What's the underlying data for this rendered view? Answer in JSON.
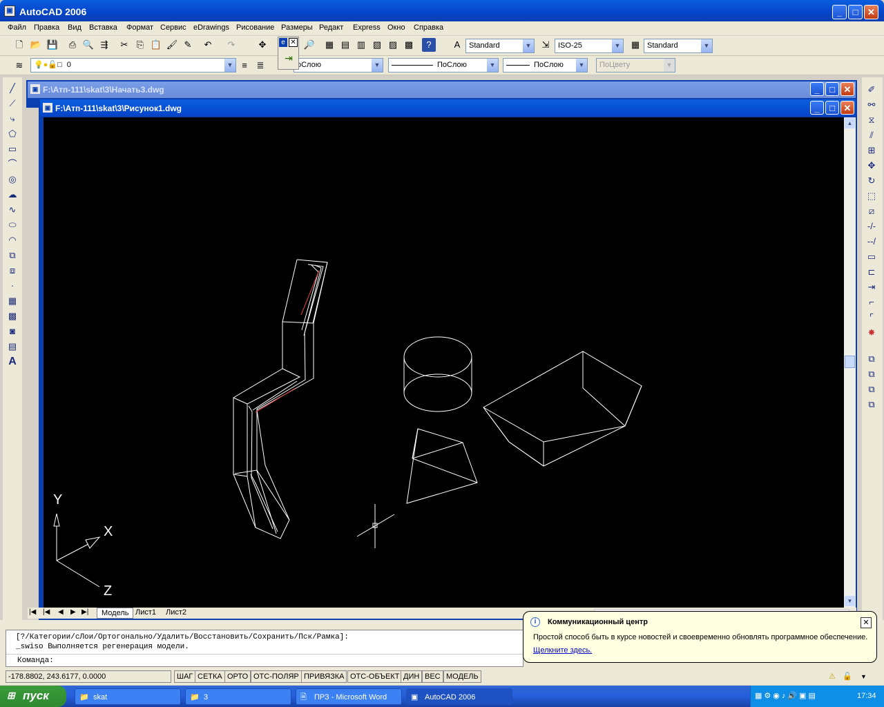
{
  "app": {
    "title": "AutoCAD 2006"
  },
  "menu": [
    "Файл",
    "Правка",
    "Вид",
    "Вставка",
    "Формат",
    "Сервис",
    "eDrawings",
    "Рисование",
    "Размеры",
    "Редакт",
    "Express",
    "Окно",
    "Справка"
  ],
  "styles": {
    "text_style": "Standard",
    "dim_style": "ISO-25",
    "table_style": "Standard"
  },
  "layers": {
    "current_layer": "0",
    "color": "оСлою",
    "linetype": "ПоСлою",
    "lineweight": "ПоСлою",
    "plotstyle": "ПоЦвету"
  },
  "popup_toolbar": {
    "label": "e"
  },
  "documents": [
    {
      "title": "F:\\Атп-111\\skat\\3\\Начать3.dwg"
    },
    {
      "title": "F:\\Атп-111\\skat\\3\\Рисунок1.dwg"
    }
  ],
  "ucs": {
    "y": "Y",
    "x": "X",
    "z": "Z"
  },
  "layout_tabs": [
    "Модель",
    "Лист1",
    "Лист2"
  ],
  "command": {
    "line1": "[?/Категории/сЛои/Ортогонально/Удалить/Восстановить/Сохранить/Пск/Рамка]:",
    "line2": "_swiso Выполняется регенерация модели.",
    "prompt": "Команда:"
  },
  "status": {
    "coords": "-178.8802, 243.6177, 0.0000",
    "buttons": [
      "ШАГ",
      "СЕТКА",
      "ОРТО",
      "ОТС-ПОЛЯР",
      "ПРИВЯЗКА",
      "ОТС-ОБЪЕКТ",
      "ДИН",
      "ВЕС",
      "МОДЕЛЬ"
    ]
  },
  "balloon": {
    "title": "Коммуникационный центр",
    "text": "Простой способ быть в курсе новостей и своевременно обновлять программное обеспечение.",
    "link": "Щелкните здесь."
  },
  "taskbar": {
    "start": "пуск",
    "tasks": [
      "skat",
      "3",
      "ПРЗ - Microsoft Word",
      "AutoCAD 2006"
    ],
    "clock": "17:34"
  }
}
